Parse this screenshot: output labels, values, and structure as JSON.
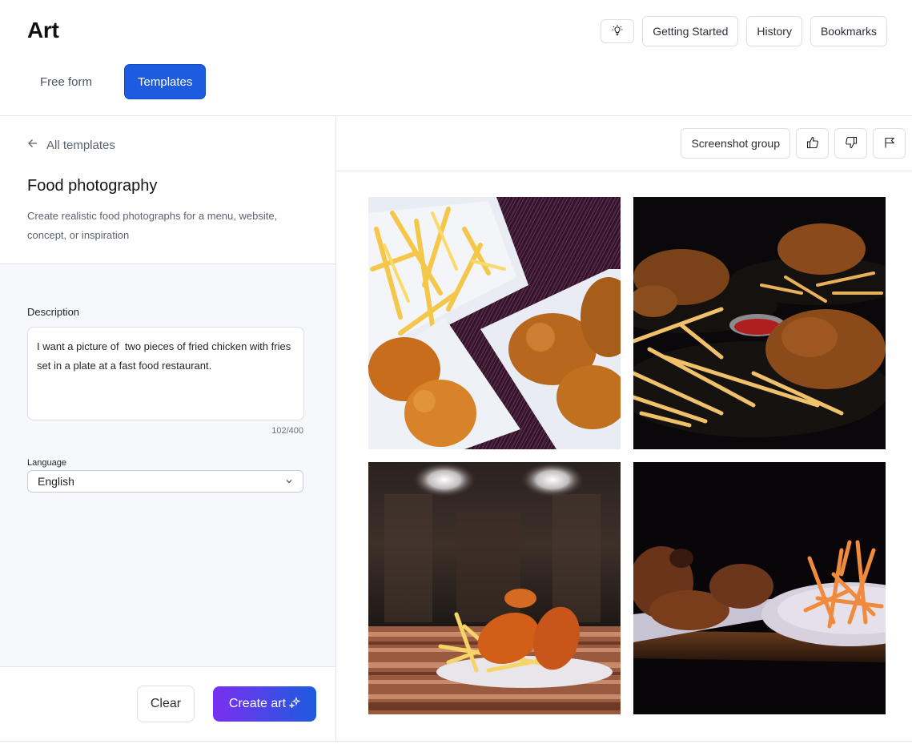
{
  "app": {
    "title": "Art"
  },
  "header": {
    "tabs": [
      {
        "label": "Free form",
        "active": false
      },
      {
        "label": "Templates",
        "active": true
      }
    ],
    "actions": {
      "tip_icon": "lightbulb-icon",
      "getting_started": "Getting Started",
      "history": "History",
      "bookmarks": "Bookmarks"
    }
  },
  "left_panel": {
    "back_link": "All templates",
    "template_title": "Food photography",
    "template_description": "Create realistic food photographs for a menu, website, concept, or inspiration",
    "description_label": "Description",
    "description_value": "I want a picture of  two pieces of fried chicken with fries set in a plate at a fast food restaurant.",
    "char_count": "102/400",
    "language_label": "Language",
    "language_value": "English",
    "clear_label": "Clear",
    "create_label": "Create art"
  },
  "right_panel": {
    "screenshot_group_label": "Screenshot group",
    "feedback_icons": [
      "thumbs-up-icon",
      "thumbs-down-icon",
      "flag-icon"
    ],
    "images": [
      {
        "alt": "Fried chicken and fries on white square plates on a purple wood table"
      },
      {
        "alt": "Fried chicken with fries and ketchup on black plates, dark background"
      },
      {
        "alt": "Fried chicken drumsticks with fries on a plate on a striped wooden board, blurred restaurant lights"
      },
      {
        "alt": "Fried chicken pieces and a bowl of fries on a dark table"
      }
    ]
  },
  "colors": {
    "accent": "#1d5be0",
    "gradient_start": "#7a2ff0",
    "gradient_end": "#1d5be0",
    "panel_bg": "#f6f8fb",
    "border": "#e3e5e8"
  }
}
